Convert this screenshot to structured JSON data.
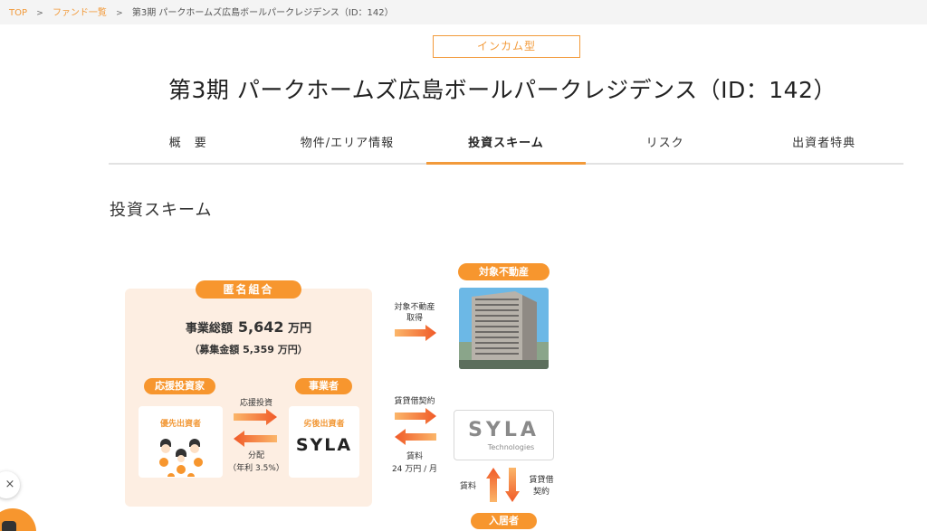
{
  "breadcrumb": {
    "top": "TOP",
    "fund_list": "ファンド一覧",
    "current": "第3期 パークホームズ広島ボールパークレジデンス（ID：142）",
    "separator": ">"
  },
  "badge": "インカム型",
  "page_title": "第3期 パークホームズ広島ボールパークレジデンス（ID：142）",
  "tabs": [
    {
      "label": "概　要",
      "active": false
    },
    {
      "label": "物件/エリア情報",
      "active": false
    },
    {
      "label": "投資スキーム",
      "active": true
    },
    {
      "label": "リスク",
      "active": false
    },
    {
      "label": "出資者特典",
      "active": false
    }
  ],
  "section_title": "投資スキーム",
  "diagram": {
    "kumiai": "匿名組合",
    "total_label": "事業総額",
    "total_value": "5,642",
    "total_unit": "万円",
    "raise_text": "（募集金額 5,359 万円）",
    "investor_pill": "応援投資家",
    "operator_pill": "事業者",
    "priority_label": "優先出資者",
    "subordinate_label": "劣後出資者",
    "syla_logo": "SYLA",
    "invest_label": "応援投資",
    "distribution_label": "分配",
    "distribution_rate": "（年利 3.5%）",
    "acquire_label_1": "対象不動産",
    "acquire_label_2": "取得",
    "target_pill": "対象不動産",
    "lease_label": "賃貸借契約",
    "rent_label_1": "賃料",
    "rent_label_2": "24 万円 / 月",
    "syla_tech_logo": "SYLA",
    "syla_tech_sub": "Technologies",
    "rent_small": "賃料",
    "lease_small_1": "賃貸借",
    "lease_small_2": "契約",
    "resident_pill": "入居者"
  },
  "widgets": {
    "close_glyph": "×"
  },
  "colors": {
    "accent": "#f7962e",
    "panel_bg": "#fdeee2"
  }
}
